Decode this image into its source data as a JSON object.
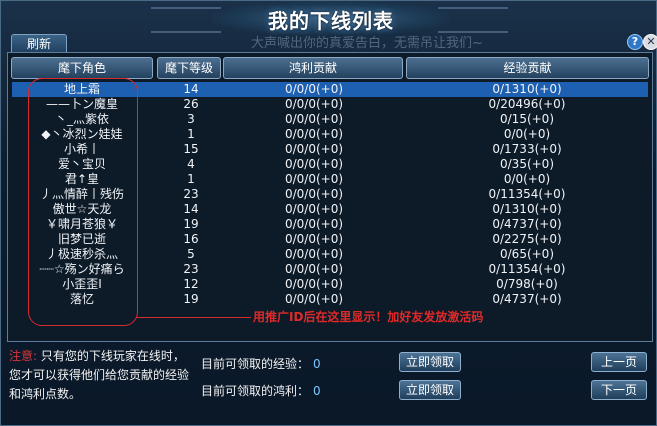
{
  "window": {
    "title": "我的下线列表",
    "ghost_text": "大声喊出你的真爱告白，无需吊让我们~",
    "help_icon": "?",
    "close_icon": "✕"
  },
  "toolbar": {
    "refresh_label": "刷新"
  },
  "columns": [
    "麾下角色",
    "麾下等级",
    "鸿利贡献",
    "经验贡献"
  ],
  "rows": [
    {
      "name": "地上霜",
      "level": "14",
      "honglin": "0/0/0(+0)",
      "exp": "0/1310(+0)"
    },
    {
      "name": "——卜ン魔皇",
      "level": "26",
      "honglin": "0/0/0(+0)",
      "exp": "0/20496(+0)"
    },
    {
      "name": "丶_灬紫依",
      "level": "3",
      "honglin": "0/0/0(+0)",
      "exp": "0/15(+0)"
    },
    {
      "name": "◆丶冰烈ン娃娃",
      "level": "1",
      "honglin": "0/0/0(+0)",
      "exp": "0/0(+0)"
    },
    {
      "name": "小希丨",
      "level": "15",
      "honglin": "0/0/0(+0)",
      "exp": "0/1733(+0)"
    },
    {
      "name": "爱丶宝贝",
      "level": "4",
      "honglin": "0/0/0(+0)",
      "exp": "0/35(+0)"
    },
    {
      "name": "君↑皇",
      "level": "1",
      "honglin": "0/0/0(+0)",
      "exp": "0/0(+0)"
    },
    {
      "name": "丿灬情醉丨残伤",
      "level": "23",
      "honglin": "0/0/0(+0)",
      "exp": "0/11354(+0)"
    },
    {
      "name": "傲世☆天龙",
      "level": "14",
      "honglin": "0/0/0(+0)",
      "exp": "0/1310(+0)"
    },
    {
      "name": "￥啸月苍狼￥",
      "level": "19",
      "honglin": "0/0/0(+0)",
      "exp": "0/4737(+0)"
    },
    {
      "name": "旧梦已逝",
      "level": "16",
      "honglin": "0/0/0(+0)",
      "exp": "0/2275(+0)"
    },
    {
      "name": "丿极速秒杀灬",
      "level": "5",
      "honglin": "0/0/0(+0)",
      "exp": "0/65(+0)"
    },
    {
      "name": "┈┈☆殇ン好痛ら",
      "level": "23",
      "honglin": "0/0/0(+0)",
      "exp": "0/11354(+0)"
    },
    {
      "name": "小歪歪I",
      "level": "12",
      "honglin": "0/0/0(+0)",
      "exp": "0/798(+0)"
    },
    {
      "name": "落忆",
      "level": "19",
      "honglin": "0/0/0(+0)",
      "exp": "0/4737(+0)"
    }
  ],
  "annotation": "用推广ID后在这里显示！加好友发放激活码",
  "note": {
    "label": "注意:",
    "text": "只有您的下线玩家在线时，您才可以获得他们给您贡献的经验和鸿利点数。"
  },
  "claims": {
    "exp_label": "目前可领取的经验：",
    "exp_value": "0",
    "honglin_label": "目前可领取的鸿利：",
    "honglin_value": "0",
    "claim_button": "立即领取"
  },
  "pager": {
    "prev": "上一页",
    "next": "下一页"
  },
  "colors": {
    "selected_row": "#1d5fb0",
    "annotation": "#d82b2b",
    "note_label": "#d9363a",
    "value": "#79c6ff"
  }
}
